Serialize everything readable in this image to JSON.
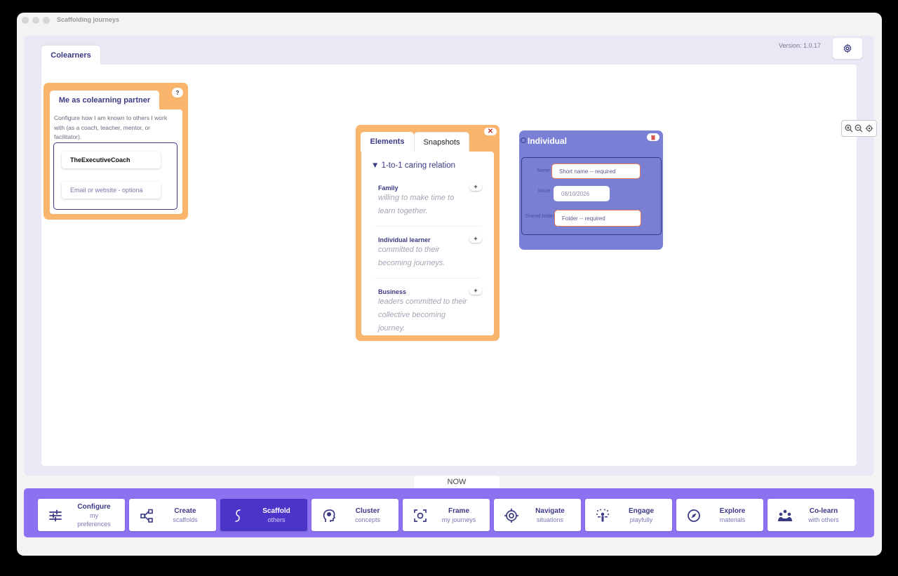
{
  "window": {
    "title": "Scaffolding journeys"
  },
  "header": {
    "tab_label": "Colearners",
    "version": "Version: 1.0.17"
  },
  "partner_card": {
    "title": "Me as colearning partner",
    "help": "?",
    "description": "Configure how I am known to others I work with (as a coach, teacher, mentor, or facilitator).",
    "name_value": "TheExecutiveCoach",
    "email_placeholder": "Email or website - optiona"
  },
  "elements_card": {
    "tabs": [
      "Elements",
      "Snapshots"
    ],
    "close": "✕",
    "group": "▼ 1-to-1 caring relation",
    "items": [
      {
        "name": "Family",
        "desc": "willing to make time to learn together.",
        "add": "+"
      },
      {
        "name": "Individual learner",
        "desc": "committed to their becoming journeys.",
        "add": "+"
      },
      {
        "name": "Business",
        "desc": "leaders committed to their collective becoming journey.",
        "add": "+"
      }
    ]
  },
  "individual_card": {
    "title": "Individual",
    "name_label": "Name",
    "name_placeholder": "Short name -- required",
    "since_label": "Since",
    "since_value": "08/10/2026",
    "folder_label": "Shared folder",
    "folder_placeholder": "Folder -- required"
  },
  "now_label": "NOW",
  "nav": [
    {
      "main": "Configure",
      "sub": "my preferences",
      "icon": "sliders-icon",
      "active": false
    },
    {
      "main": "Create",
      "sub": "scaffolds",
      "icon": "nodes-icon",
      "active": false
    },
    {
      "main": "Scaffold",
      "sub": "others",
      "icon": "path-s-icon",
      "active": true
    },
    {
      "main": "Cluster",
      "sub": "concepts",
      "icon": "head-brain-icon",
      "active": false
    },
    {
      "main": "Frame",
      "sub": "my journeys",
      "icon": "frame-target-icon",
      "active": false
    },
    {
      "main": "Navigate",
      "sub": "situations",
      "icon": "crosshair-icon",
      "active": false
    },
    {
      "main": "Engage",
      "sub": "playfully",
      "icon": "confetti-person-icon",
      "active": false
    },
    {
      "main": "Explore",
      "sub": "materials",
      "icon": "compass-icon",
      "active": false
    },
    {
      "main": "Co-learn",
      "sub": "with others",
      "icon": "group-icon",
      "active": false
    }
  ],
  "colors": {
    "accent": "#3b3a85",
    "card_orange": "#f9b56b",
    "card_purple": "#7a80d6",
    "bar": "#8c71f0",
    "active": "#4a35c8"
  }
}
